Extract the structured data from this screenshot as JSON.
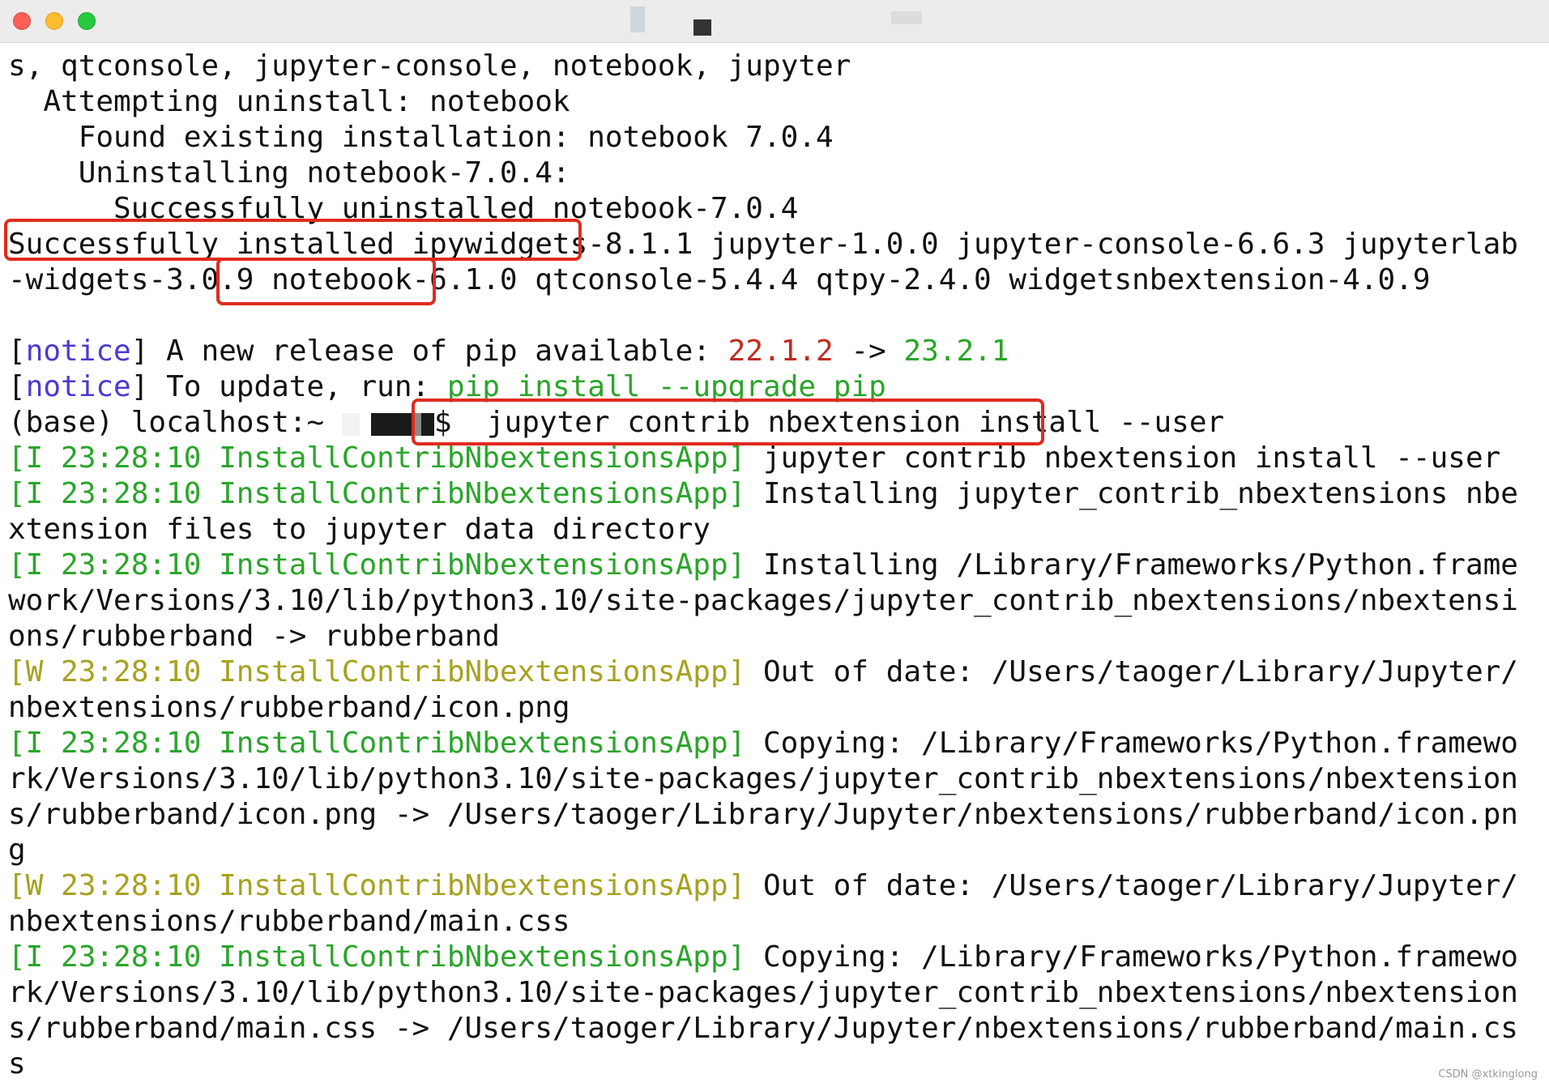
{
  "window": {
    "controls": [
      "close",
      "minimize",
      "maximize"
    ],
    "colors": {
      "close": "#fe5f57",
      "minimize": "#febc2e",
      "maximize": "#28c840"
    }
  },
  "terminal": {
    "lines": [
      {
        "text": "s, qtconsole, jupyter-console, notebook, jupyter"
      },
      {
        "text": "  Attempting uninstall: notebook"
      },
      {
        "text": "    Found existing installation: notebook 7.0.4"
      },
      {
        "text": "    Uninstalling notebook-7.0.4:"
      },
      {
        "text": "      Successfully uninstalled notebook-7.0.4"
      },
      {
        "text": "Successfully installed ipywidgets-8.1.1 jupyter-1.0.0 jupyter-console-6.6.3 jupyterlab"
      },
      {
        "text": "-widgets-3.0.9 notebook-6.1.0 qtconsole-5.4.4 qtpy-2.4.0 widgetsnbextension-4.0.9"
      },
      {
        "text": ""
      }
    ],
    "notice1": {
      "bracket_open": "[",
      "tag": "notice",
      "bracket_close": "]",
      "text": " A new release of pip available: ",
      "old_version": "22.1.2",
      "arrow": " -> ",
      "new_version": "23.2.1"
    },
    "notice2": {
      "bracket_open": "[",
      "tag": "notice",
      "bracket_close": "]",
      "text": " To update, run: ",
      "command": "pip install --upgrade pip"
    },
    "prompt": {
      "prefix": "(base) localhost:~ ",
      "suffix": "$ ",
      "command": "jupyter contrib nbextension install --user"
    },
    "log": [
      {
        "tag": "[I 23:28:10 InstallContribNbextensionsApp]",
        "level": "I",
        "text": " jupyter contrib nbextension install --user"
      },
      {
        "tag": "[I 23:28:10 InstallContribNbextensionsApp]",
        "level": "I",
        "text": " Installing jupyter_contrib_nbextensions nbe"
      },
      {
        "tag": "",
        "level": "",
        "text": "xtension files to jupyter data directory"
      },
      {
        "tag": "[I 23:28:10 InstallContribNbextensionsApp]",
        "level": "I",
        "text": " Installing /Library/Frameworks/Python.frame"
      },
      {
        "tag": "",
        "level": "",
        "text": "work/Versions/3.10/lib/python3.10/site-packages/jupyter_contrib_nbextensions/nbextensi"
      },
      {
        "tag": "",
        "level": "",
        "text": "ons/rubberband -> rubberband"
      },
      {
        "tag": "[W 23:28:10 InstallContribNbextensionsApp]",
        "level": "W",
        "text": " Out of date: /Users/taoger/Library/Jupyter/"
      },
      {
        "tag": "",
        "level": "",
        "text": "nbextensions/rubberband/icon.png"
      },
      {
        "tag": "[I 23:28:10 InstallContribNbextensionsApp]",
        "level": "I",
        "text": " Copying: /Library/Frameworks/Python.framewo"
      },
      {
        "tag": "",
        "level": "",
        "text": "rk/Versions/3.10/lib/python3.10/site-packages/jupyter_contrib_nbextensions/nbextension"
      },
      {
        "tag": "",
        "level": "",
        "text": "s/rubberband/icon.png -> /Users/taoger/Library/Jupyter/nbextensions/rubberband/icon.pn"
      },
      {
        "tag": "",
        "level": "",
        "text": "g"
      },
      {
        "tag": "[W 23:28:10 InstallContribNbextensionsApp]",
        "level": "W",
        "text": " Out of date: /Users/taoger/Library/Jupyter/"
      },
      {
        "tag": "",
        "level": "",
        "text": "nbextensions/rubberband/main.css"
      },
      {
        "tag": "[I 23:28:10 InstallContribNbextensionsApp]",
        "level": "I",
        "text": " Copying: /Library/Frameworks/Python.framewo"
      },
      {
        "tag": "",
        "level": "",
        "text": "rk/Versions/3.10/lib/python3.10/site-packages/jupyter_contrib_nbextensions/nbextension"
      },
      {
        "tag": "",
        "level": "",
        "text": "s/rubberband/main.css -> /Users/taoger/Library/Jupyter/nbextensions/rubberband/main.cs"
      },
      {
        "tag": "",
        "level": "",
        "text": "s"
      }
    ],
    "colors": {
      "notice": "#4a3bd0",
      "version_old": "#c12a1f",
      "version_new": "#2aa52a",
      "info_tag": "#2aa52a",
      "warn_tag": "#a6a220",
      "highlight_box": "#e02b20"
    }
  },
  "watermark": "CSDN @xtkinglong"
}
